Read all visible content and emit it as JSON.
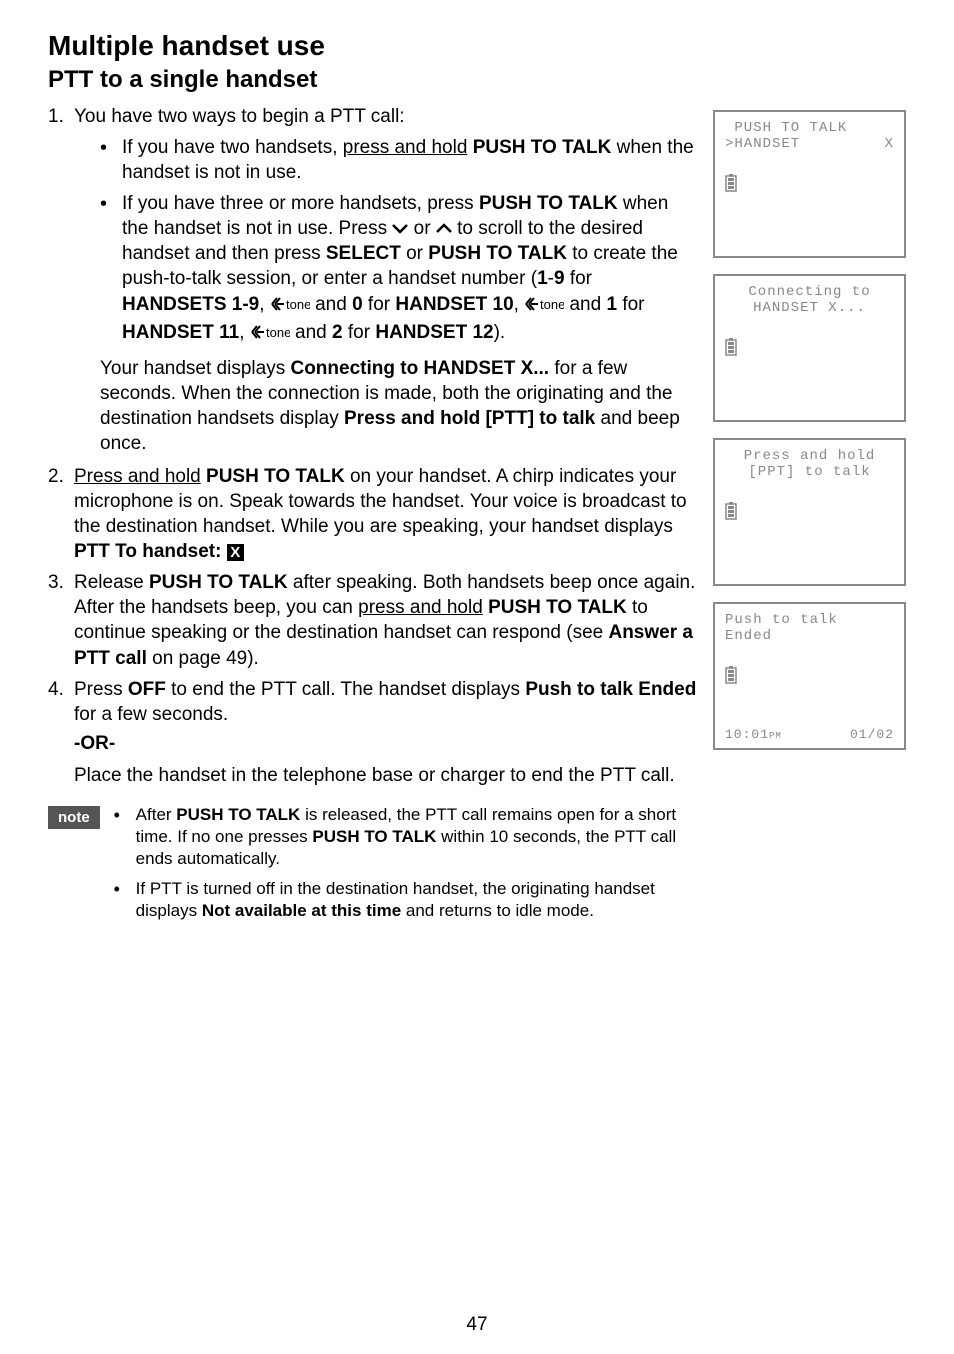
{
  "h1": "Multiple handset use",
  "h2": "PTT to a single handset",
  "step1_intro": "You have two ways to begin a PTT call:",
  "step1_b1_pre": "If you have two handsets, ",
  "step1_b1_ul": "press and hold",
  "step1_b1_mid": " ",
  "step1_b1_bold": "PUSH TO TALK",
  "step1_b1_post": " when the handset is not in use.",
  "step1_b2_a": "If you have three or more handsets, press ",
  "step1_b2_b": "PUSH TO TALK",
  "step1_b2_c": " when the handset is not in use. Press ",
  "step1_b2_d": " or ",
  "step1_b2_e": " to scroll to the desired handset and then press ",
  "step1_b2_f": "SELECT",
  "step1_b2_g": " or ",
  "step1_b2_h": "PUSH TO TALK",
  "step1_b2_i": " to create the push-to-talk session, or enter a handset number (",
  "step1_b2_j": "1",
  "step1_b2_k": "-",
  "step1_b2_l": "9",
  "step1_b2_m": " for ",
  "step1_b2_n": "HANDSETS 1-9",
  "step1_b2_o": ", ",
  "step1_b2_tone": "tone",
  "step1_b2_p": " and ",
  "step1_b2_q": "0",
  "step1_b2_r": " for ",
  "step1_b2_s": "HANDSET 10",
  "step1_b2_t": ", ",
  "step1_b2_u": " and ",
  "step1_b2_v": "1",
  "step1_b2_w": " for ",
  "step1_b2_x": "HANDSET 11",
  "step1_b2_y": ", ",
  "step1_b2_z": " and ",
  "step1_b2_aa": "2",
  "step1_b2_ab": " for ",
  "step1_b2_ac": "HANDSET 12",
  "step1_b2_ad": ").",
  "step1_p2_a": "Your handset displays ",
  "step1_p2_b": "Connecting to HANDSET X...",
  "step1_p2_c": " for a few seconds. When the connection is made, both the originating and the destination handsets display ",
  "step1_p2_d": "Press and hold [PTT] to talk",
  "step1_p2_e": " and beep once.",
  "step2_a": "",
  "step2_ul": "Press and hold",
  "step2_b": " ",
  "step2_c": "PUSH TO TALK",
  "step2_d": " on your handset. A chirp indicates your microphone is on. Speak towards the handset. Your voice is broadcast to the destination handset. While you are speaking, your handset displays ",
  "step2_e": "PTT To handset: ",
  "step2_xbox": "X",
  "step3_a": "Release ",
  "step3_b": "PUSH TO TALK",
  "step3_c": " after speaking. Both handsets beep once again. After the handsets beep, you can ",
  "step3_ul": "press and hold",
  "step3_d": " ",
  "step3_e": "PUSH TO TALK",
  "step3_f": " to continue speaking or the destination handset can respond (see ",
  "step3_g": "Answer a PTT call",
  "step3_h": " on page 49).",
  "step4_a": "Press ",
  "step4_b": "OFF",
  "step4_c": " to end the PTT call. The handset displays ",
  "step4_d": "Push to talk Ended",
  "step4_e": " for a few seconds.",
  "or_label": "-OR-",
  "or_para": "Place the handset in the telephone base or charger to end the PTT call.",
  "note_label": "note",
  "note1_a": "After ",
  "note1_b": "PUSH TO TALK",
  "note1_c": " is released, the PTT call remains open for a short time. If no one presses ",
  "note1_d": "PUSH TO TALK",
  "note1_e": " within 10 seconds, the PTT call ends automatically.",
  "note2_a": "If PTT is turned off in the destination handset, the originating handset displays ",
  "note2_b": "Not available at this time",
  "note2_c": " and returns to idle mode.",
  "screen1_l1": " PUSH TO TALK",
  "screen1_l2a": ">HANDSET",
  "screen1_l2b": "X",
  "screen2_l1": "Connecting to",
  "screen2_l2": "HANDSET X...",
  "screen3_l1": "Press and hold",
  "screen3_l2": "[PPT] to talk",
  "screen4_l1": "Push to talk",
  "screen4_l2": "Ended",
  "screen4_time": "10:01",
  "screen4_ampm": "PM",
  "screen4_date": "01/02",
  "page_num": "47"
}
